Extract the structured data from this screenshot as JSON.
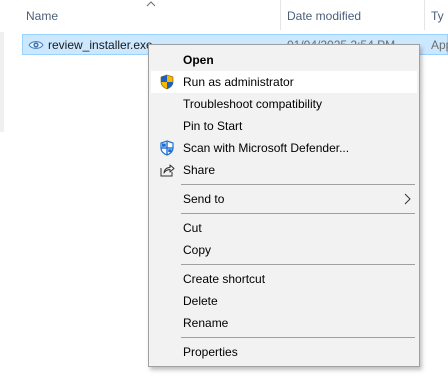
{
  "columns": {
    "name": "Name",
    "date_modified": "Date modified",
    "type": "Ty"
  },
  "file": {
    "name": "review_installer.exe",
    "date": "01/04/2025 2:54 PM",
    "type": "App"
  },
  "menu": {
    "open": "Open",
    "run_as_admin": "Run as administrator",
    "troubleshoot": "Troubleshoot compatibility",
    "pin_to_start": "Pin to Start",
    "scan_defender": "Scan with Microsoft Defender...",
    "share": "Share",
    "send_to": "Send to",
    "cut": "Cut",
    "copy": "Copy",
    "create_shortcut": "Create shortcut",
    "delete": "Delete",
    "rename": "Rename",
    "properties": "Properties"
  },
  "icons": {
    "file": "eye-icon",
    "shield": "uac-shield-icon",
    "defender": "defender-icon",
    "share": "share-icon",
    "submenu": "chevron-right-icon"
  },
  "colors": {
    "selection_bg": "#cce8ff",
    "selection_border": "#99d1ff",
    "menu_bg": "#f2f2f2",
    "header_text": "#4c607a"
  }
}
